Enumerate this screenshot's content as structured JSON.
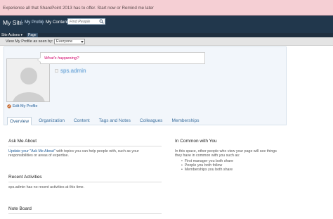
{
  "notice": {
    "text": "Experience all that SharePoint 2013 has to offer. Start now or Remind me later"
  },
  "topbar": {
    "site_title": "My Site",
    "tabs": [
      {
        "label": "My Profile"
      },
      {
        "label": "My Content"
      }
    ],
    "search_placeholder": "Find People",
    "search_icon": "magnifier-icon"
  },
  "actionbar": {
    "site_actions": "Site Actions",
    "site_actions_icon": "chevron-down-icon",
    "page_tab": "Page"
  },
  "viewbar": {
    "label": "View My Profile as seen by:",
    "selected": "Everyone"
  },
  "profile": {
    "status_prompt": "What's happening?",
    "name": "sps.admin",
    "edit_label": "Edit My Profile",
    "photo_icon": "person-silhouette-icon",
    "edit_icon": "pencil-icon"
  },
  "tabs": [
    {
      "label": "Overview"
    },
    {
      "label": "Organization"
    },
    {
      "label": "Content"
    },
    {
      "label": "Tags and Notes"
    },
    {
      "label": "Colleagues"
    },
    {
      "label": "Memberships"
    }
  ],
  "ask_me_about": {
    "title": "Ask Me About",
    "link": "Update your \"Ask Me About\"",
    "text": " with topics you can help people with, such as your responsibilities or areas of expertise."
  },
  "in_common": {
    "title": "In Common with You",
    "text": "In this space, other people who view your page will see things they have in common with you such as:",
    "items": [
      "First manager you both share",
      "People you both follow",
      "Memberships you both share"
    ]
  },
  "recent_activities": {
    "title": "Recent Activities",
    "text": "sps.admin has no recent activities at this time."
  },
  "note_board": {
    "title": "Note Board"
  }
}
